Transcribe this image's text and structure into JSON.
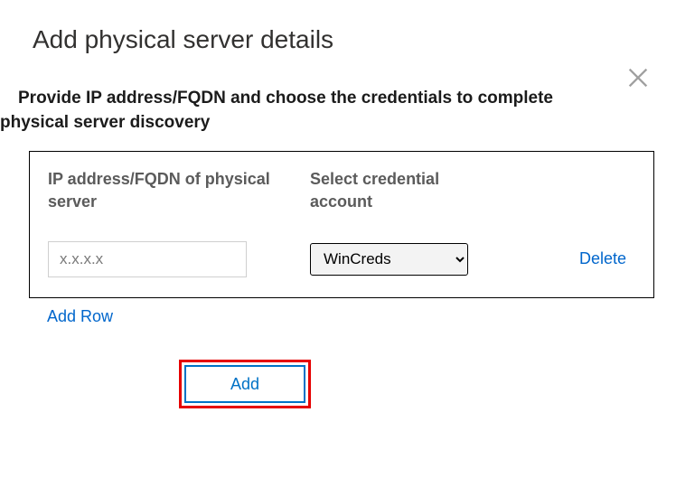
{
  "title": "Add physical server details",
  "description_line1": "Provide IP address/FQDN and choose the credentials to complete",
  "description_line2": "physical server discovery",
  "headers": {
    "ip": "IP address/FQDN of physical server",
    "cred": "Select credential account"
  },
  "rows": [
    {
      "ip_value": "x.x.x.x",
      "credential_selected": "WinCreds",
      "delete_label": "Delete"
    }
  ],
  "actions": {
    "add_row": "Add Row",
    "add": "Add"
  },
  "colors": {
    "link": "#0066cc",
    "button_border": "#0072c6",
    "highlight_border": "#e60000"
  }
}
